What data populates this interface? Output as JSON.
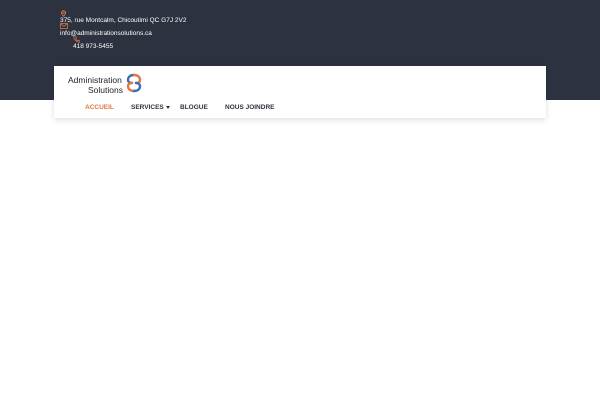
{
  "topbar": {
    "address": "375, rue Montcalm, Chicoutimi QC G7J 2V2",
    "email": "info@administrationsolutions.ca",
    "phone": "418 973-5455",
    "icons": {
      "address": "map-pin-icon",
      "email": "mail-icon",
      "phone": "phone-icon"
    },
    "colors": {
      "background": "#2c3240",
      "icon_accent": "#e0773f"
    }
  },
  "header": {
    "logo": {
      "line1": "Administration",
      "line2": "Solutions"
    },
    "nav": {
      "items": [
        {
          "label": "ACCUEIL",
          "active": true
        },
        {
          "label": "SERVICES",
          "has_dropdown": true
        },
        {
          "label": "BLOGUE"
        },
        {
          "label": "NOUS JOINDRE"
        }
      ]
    },
    "colors": {
      "active_link": "#e0773f",
      "link": "#2c3240"
    }
  }
}
